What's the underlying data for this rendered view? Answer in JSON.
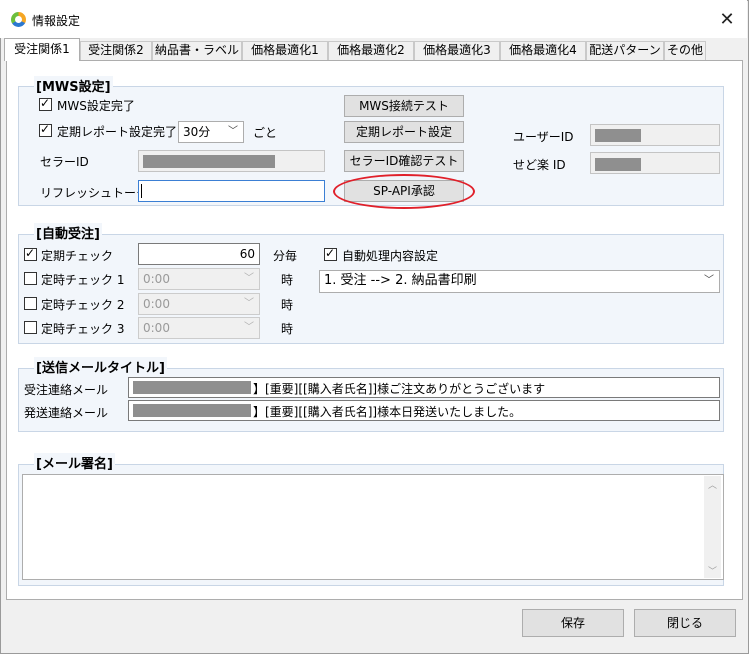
{
  "window": {
    "title": "情報設定",
    "close_glyph": "✕"
  },
  "tabs": [
    {
      "label": "受注関係1",
      "active": true
    },
    {
      "label": "受注関係2"
    },
    {
      "label": "納品書・ラベル"
    },
    {
      "label": "価格最適化1"
    },
    {
      "label": "価格最適化2"
    },
    {
      "label": "価格最適化3"
    },
    {
      "label": "価格最適化4"
    },
    {
      "label": "配送パターン"
    },
    {
      "label": "その他"
    }
  ],
  "mws": {
    "title": "[MWS設定]",
    "setup_complete_label": "MWS設定完了",
    "periodic_report_label": "定期レポート設定完了",
    "periodic_interval": "30分",
    "every_label": "ごと",
    "seller_id_label": "セラーID",
    "refresh_token_label": "リフレッシュトークン",
    "refresh_token_value": "",
    "btn_connect_test": "MWS接続テスト",
    "btn_report_settings": "定期レポート設定",
    "btn_seller_id_test": "セラーID確認テスト",
    "btn_spapi": "SP-API承認",
    "user_id_label": "ユーザーID",
    "sedoraku_id_label": "せど楽 ID"
  },
  "auto": {
    "title": "[自動受注]",
    "periodic_check_label": "定期チェック",
    "periodic_check_value": "60",
    "per_minutes_label": "分毎",
    "auto_process_label": "自動処理内容設定",
    "auto_process_value": "1. 受注 --> 2. 納品書印刷",
    "timed_checks": [
      {
        "label": "定時チェック 1",
        "time": "0:00",
        "unit": "時"
      },
      {
        "label": "定時チェック 2",
        "time": "0:00",
        "unit": "時"
      },
      {
        "label": "定時チェック 3",
        "time": "0:00",
        "unit": "時"
      }
    ]
  },
  "mail_title": {
    "title": "[送信メールタイトル]",
    "order_label": "受注連絡メール",
    "order_value": "】[重要][[購入者氏名]]様ご注文ありがとうございます",
    "ship_label": "発送連絡メール",
    "ship_value": "】[重要][[購入者氏名]]様本日発送いたしました。"
  },
  "signature": {
    "title": "[メール署名]",
    "value": ""
  },
  "footer": {
    "save": "保存",
    "close": "閉じる"
  },
  "colors": {
    "highlight_ellipse": "#e0202a",
    "section_bg": "#f2f6fb"
  }
}
